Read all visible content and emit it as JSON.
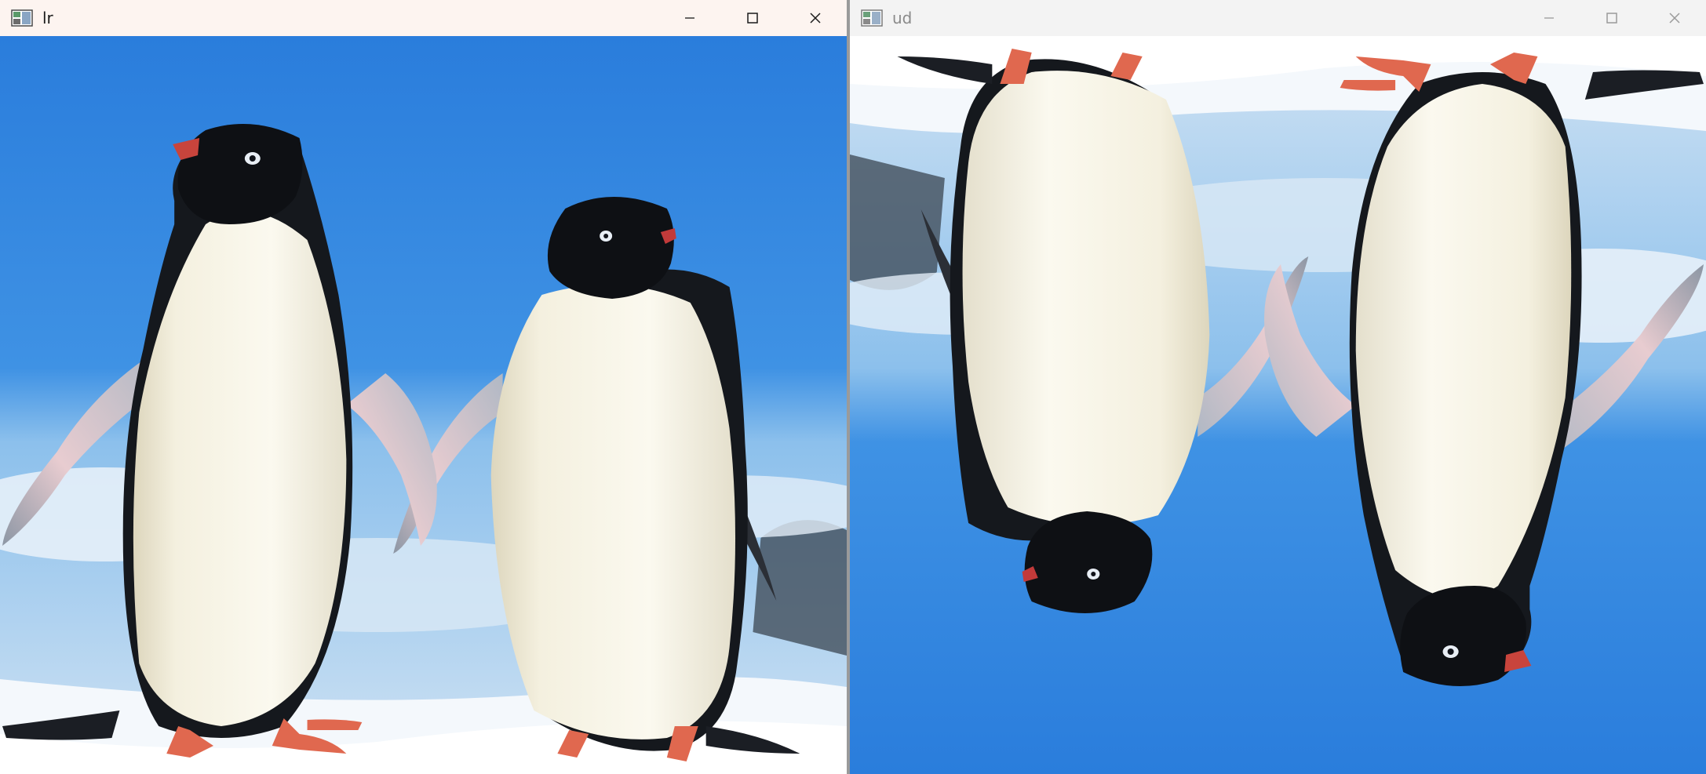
{
  "windows": {
    "left": {
      "title": "lr"
    },
    "right": {
      "title": "ud"
    }
  },
  "icons": {
    "app": "app-window-icon",
    "minimize": "minimize-icon",
    "maximize": "maximize-icon",
    "close": "close-icon"
  },
  "colors": {
    "sky": "#2f86df",
    "sky_light": "#6fb2ee",
    "snow": "#f4f8fc",
    "penguin_black": "#111418",
    "penguin_white": "#f4f1e3",
    "feet": "#e0684f"
  }
}
